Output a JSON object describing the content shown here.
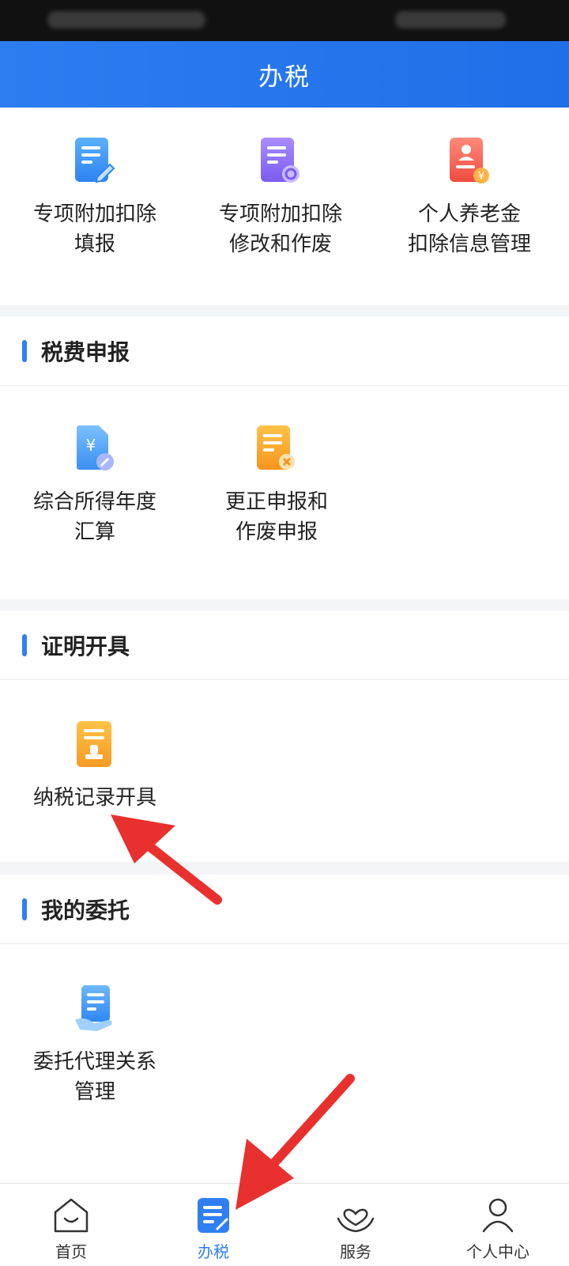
{
  "header": {
    "title": "办税"
  },
  "quick_items": [
    {
      "line1": "专项附加扣除",
      "line2": "填报",
      "icon": "doc-edit-icon"
    },
    {
      "line1": "专项附加扣除",
      "line2": "修改和作废",
      "icon": "doc-settings-icon"
    },
    {
      "line1": "个人养老金",
      "line2": "扣除信息管理",
      "icon": "pension-card-icon"
    }
  ],
  "sections": [
    {
      "title": "税费申报",
      "items": [
        {
          "line1": "综合所得年度",
          "line2": "汇算",
          "icon": "yuan-doc-icon"
        },
        {
          "line1": "更正申报和",
          "line2": "作废申报",
          "icon": "doc-cancel-icon"
        }
      ]
    },
    {
      "title": "证明开具",
      "items": [
        {
          "line1": "纳税记录开具",
          "line2": "",
          "icon": "certificate-stamp-icon"
        }
      ]
    },
    {
      "title": "我的委托",
      "items": [
        {
          "line1": "委托代理关系",
          "line2": "管理",
          "icon": "hand-doc-icon"
        }
      ]
    }
  ],
  "tabs": [
    {
      "label": "首页",
      "icon": "home-icon",
      "active": false
    },
    {
      "label": "办税",
      "icon": "tax-doc-icon",
      "active": true
    },
    {
      "label": "服务",
      "icon": "heart-hands-icon",
      "active": false
    },
    {
      "label": "个人中心",
      "icon": "user-icon",
      "active": false
    }
  ],
  "colors": {
    "accent": "#2f7ff2",
    "annotation": "#e8312f"
  }
}
